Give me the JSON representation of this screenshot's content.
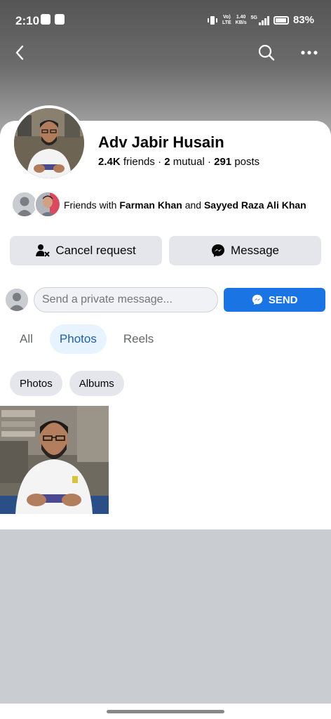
{
  "status_bar": {
    "time": "2:10",
    "network_line1": "Vo)",
    "network_line2": "LTE",
    "speed_line1": "1.40",
    "speed_line2": "KB/s",
    "network_type": "5G",
    "battery": "83%"
  },
  "nav": {
    "back_icon": "back-arrow",
    "search_icon": "search",
    "more_icon": "more-horizontal"
  },
  "profile": {
    "name": "Adv Jabir Husain",
    "friends_count": "2.4K",
    "friends_label": "friends",
    "mutual_count": "2",
    "mutual_label": "mutual",
    "posts_count": "291",
    "posts_label": "posts",
    "separator": "·"
  },
  "mutual_friends": {
    "prefix": "Friends with",
    "friend1": "Farman Khan",
    "conjunction": "and",
    "friend2": "Sayyed Raza Ali Khan"
  },
  "actions": {
    "cancel_request": "Cancel request",
    "message": "Message"
  },
  "private_message": {
    "placeholder": "Send a private message...",
    "send_label": "SEND"
  },
  "tabs": [
    {
      "label": "All",
      "active": false
    },
    {
      "label": "Photos",
      "active": true
    },
    {
      "label": "Reels",
      "active": false
    }
  ],
  "chips": [
    {
      "label": "Photos"
    },
    {
      "label": "Albums"
    }
  ],
  "colors": {
    "accent_blue": "#1b74e4",
    "active_tab_bg": "#e7f3ff",
    "active_tab_text": "#1f5fa8",
    "button_gray": "#e4e6eb"
  }
}
